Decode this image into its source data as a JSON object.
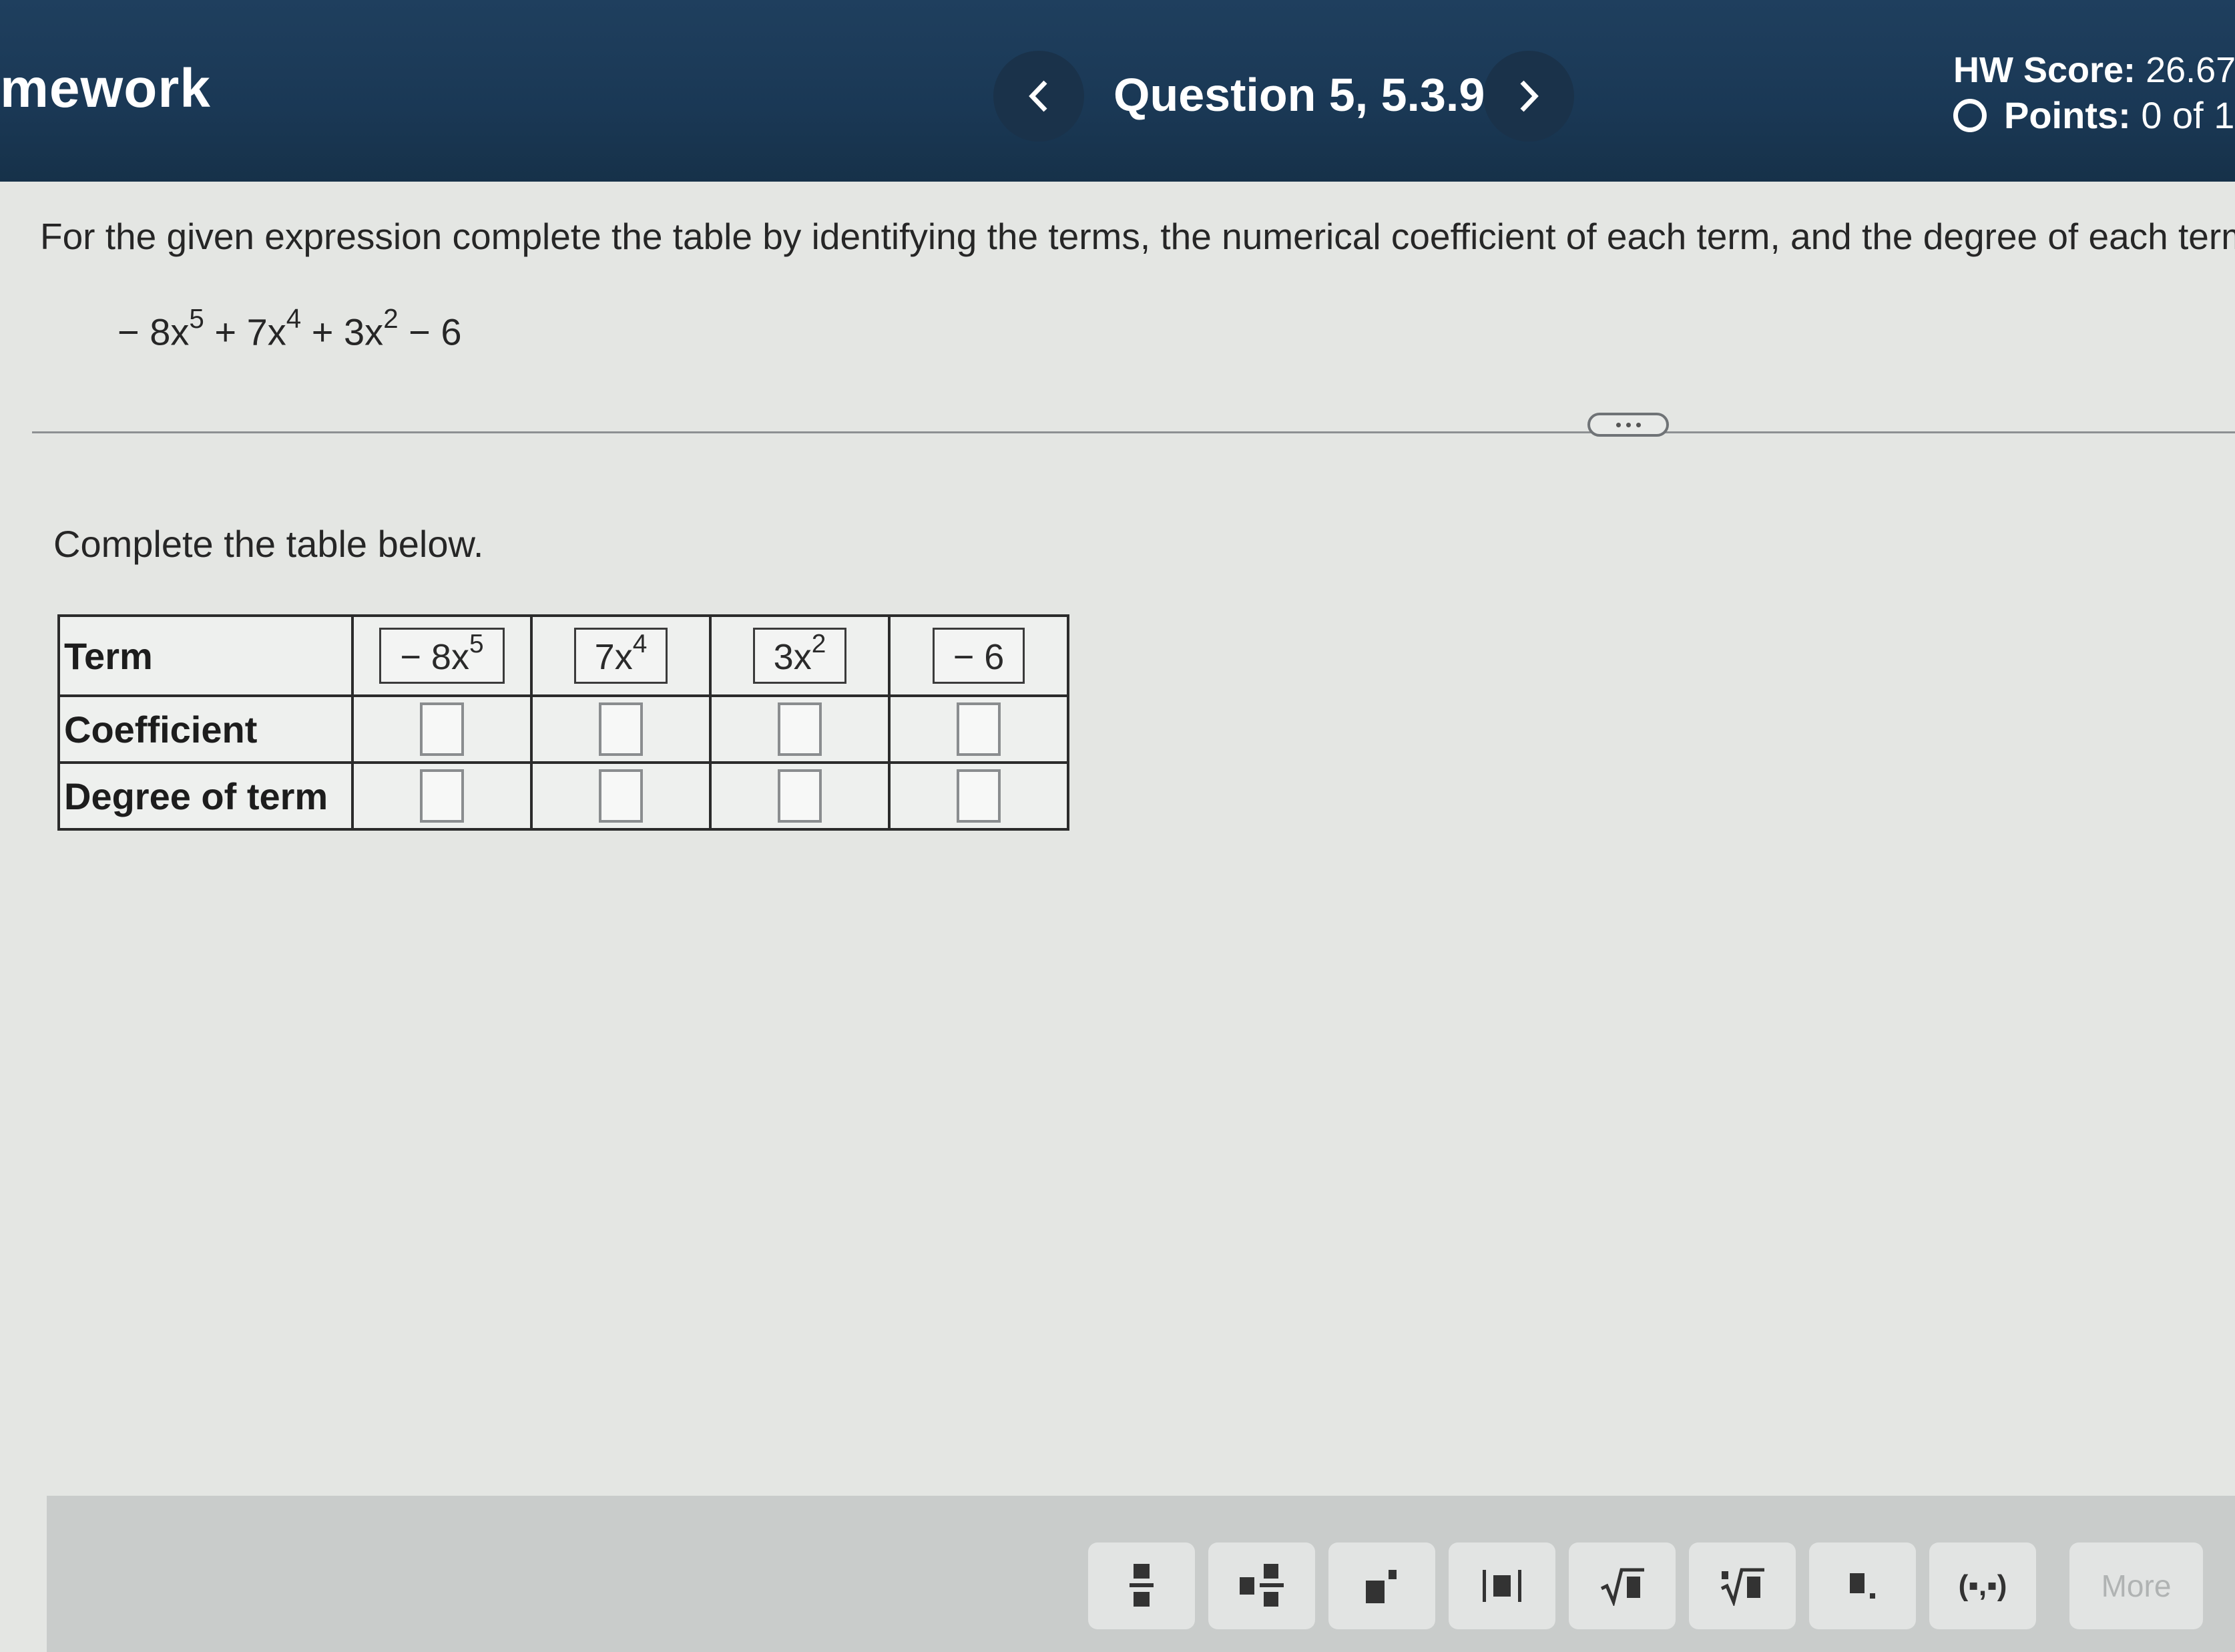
{
  "header": {
    "app_title": "mework",
    "question_label": "Question 5, 5.3.9",
    "hw_score_label": "HW Score:",
    "hw_score_value": "26.67",
    "points_label": "Points:",
    "points_value": "0 of 1"
  },
  "problem": {
    "instructions": "For the given expression complete the table by identifying the terms, the numerical coefficient of each term, and the degree of each term.",
    "expression": {
      "t1": "− 8x",
      "e1": "5",
      "t2": " + 7x",
      "e2": "4",
      "t3": " + 3x",
      "e3": "2",
      "t4": " − 6"
    }
  },
  "task_label": "Complete the table below.",
  "table": {
    "row_headers": [
      "Term",
      "Coefficient",
      "Degree of term"
    ],
    "terms": [
      {
        "base": "− 8x",
        "exp": "5"
      },
      {
        "base": "7x",
        "exp": "4"
      },
      {
        "base": "3x",
        "exp": "2"
      },
      {
        "base": "− 6",
        "exp": ""
      }
    ],
    "coefficient_values": [
      "",
      "",
      "",
      ""
    ],
    "degree_values": [
      "",
      "",
      "",
      ""
    ]
  },
  "toolbar": {
    "buttons": [
      "fraction-icon",
      "mixed-number-icon",
      "exponent-icon",
      "absolute-value-icon",
      "square-root-icon",
      "nth-root-icon",
      "decimal-icon",
      "ordered-pair-icon"
    ],
    "ordered_pair_label": "(▪,▪)",
    "more_label": "More"
  },
  "colors": {
    "header_bg": "#1f3f5e",
    "page_bg": "#e4e6e3",
    "toolbar_bg": "#c9cccb"
  }
}
